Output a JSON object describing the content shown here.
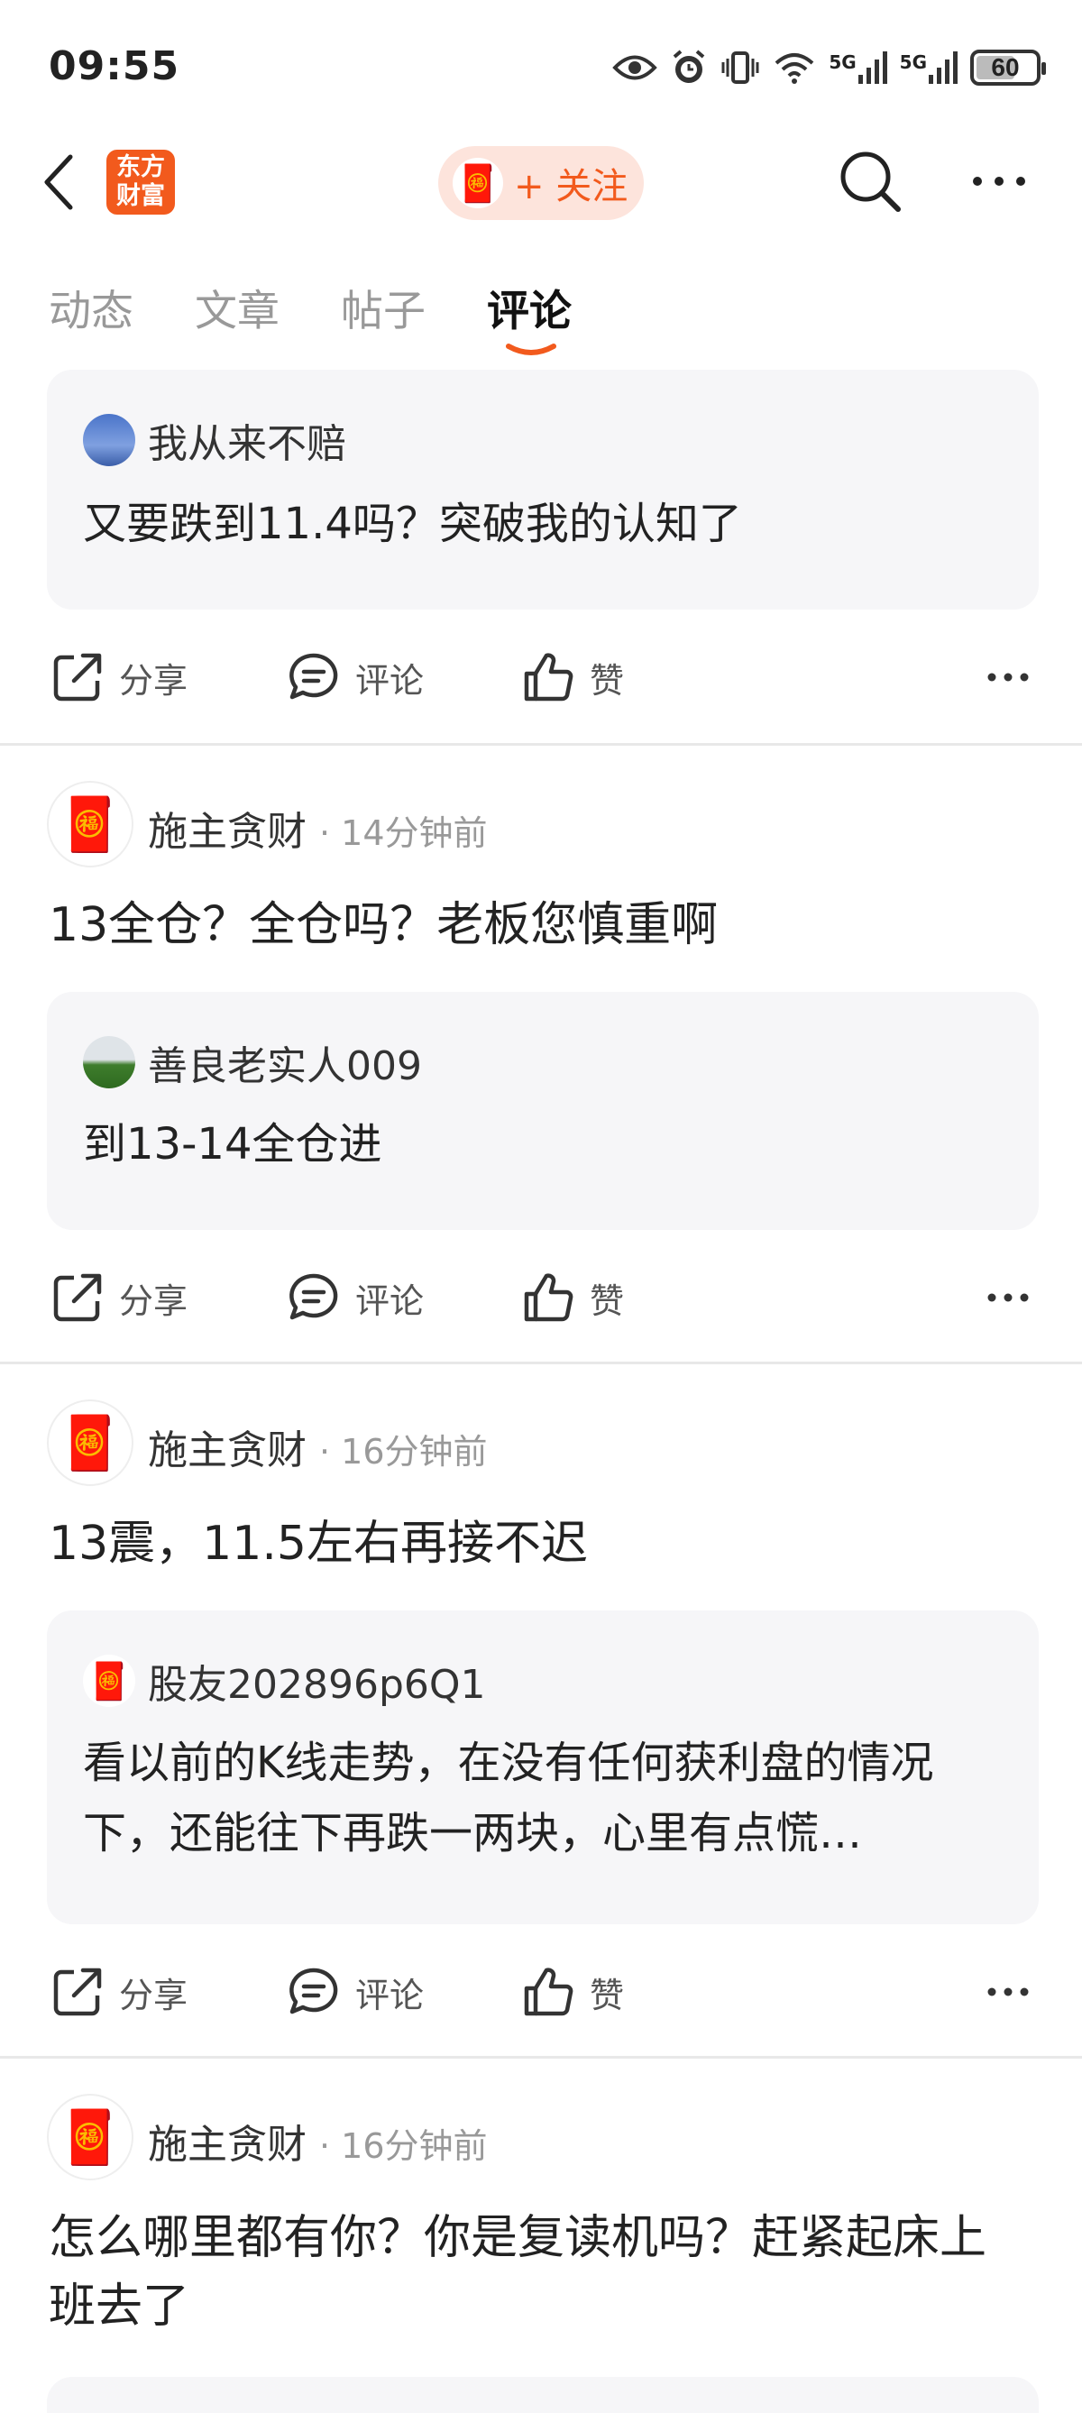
{
  "status_bar": {
    "time": "09:55",
    "network1": "5G",
    "network2": "5G",
    "battery": "60"
  },
  "header": {
    "logo_line1": "东方",
    "logo_line2": "财富",
    "follow_label": "+ 关注"
  },
  "tabs": [
    {
      "label": "动态"
    },
    {
      "label": "文章"
    },
    {
      "label": "帖子"
    },
    {
      "label": "评论",
      "active": true
    }
  ],
  "actions": {
    "share": "分享",
    "comment": "评论",
    "like": "赞"
  },
  "feed": [
    {
      "quote": {
        "user": "我从来不赔",
        "text": "又要跌到11.4吗？突破我的认知了"
      }
    },
    {
      "author": "施主贪财",
      "time": "· 14分钟前",
      "text": "13全仓？全仓吗？老板您慎重啊",
      "quote": {
        "user": "善良老实人009",
        "text": "到13-14全仓进"
      }
    },
    {
      "author": "施主贪财",
      "time": "· 16分钟前",
      "text": "13震，11.5左右再接不迟",
      "quote": {
        "user": "股友202896p6Q1",
        "text": "看以前的K线走势，在没有任何获利盘的情况下，还能往下再跌一两块，心里有点慌…"
      }
    },
    {
      "author": "施主贪财",
      "time": "· 16分钟前",
      "text": "怎么哪里都有你？你是复读机吗？赶紧起床上班去了"
    }
  ],
  "colors": {
    "accent": "#f25a1d",
    "follow_bg": "#fde4dc",
    "card_bg": "#f6f6f8"
  },
  "icons": [
    "back-icon",
    "search-icon",
    "more-icon",
    "share-icon",
    "comment-icon",
    "like-icon"
  ]
}
